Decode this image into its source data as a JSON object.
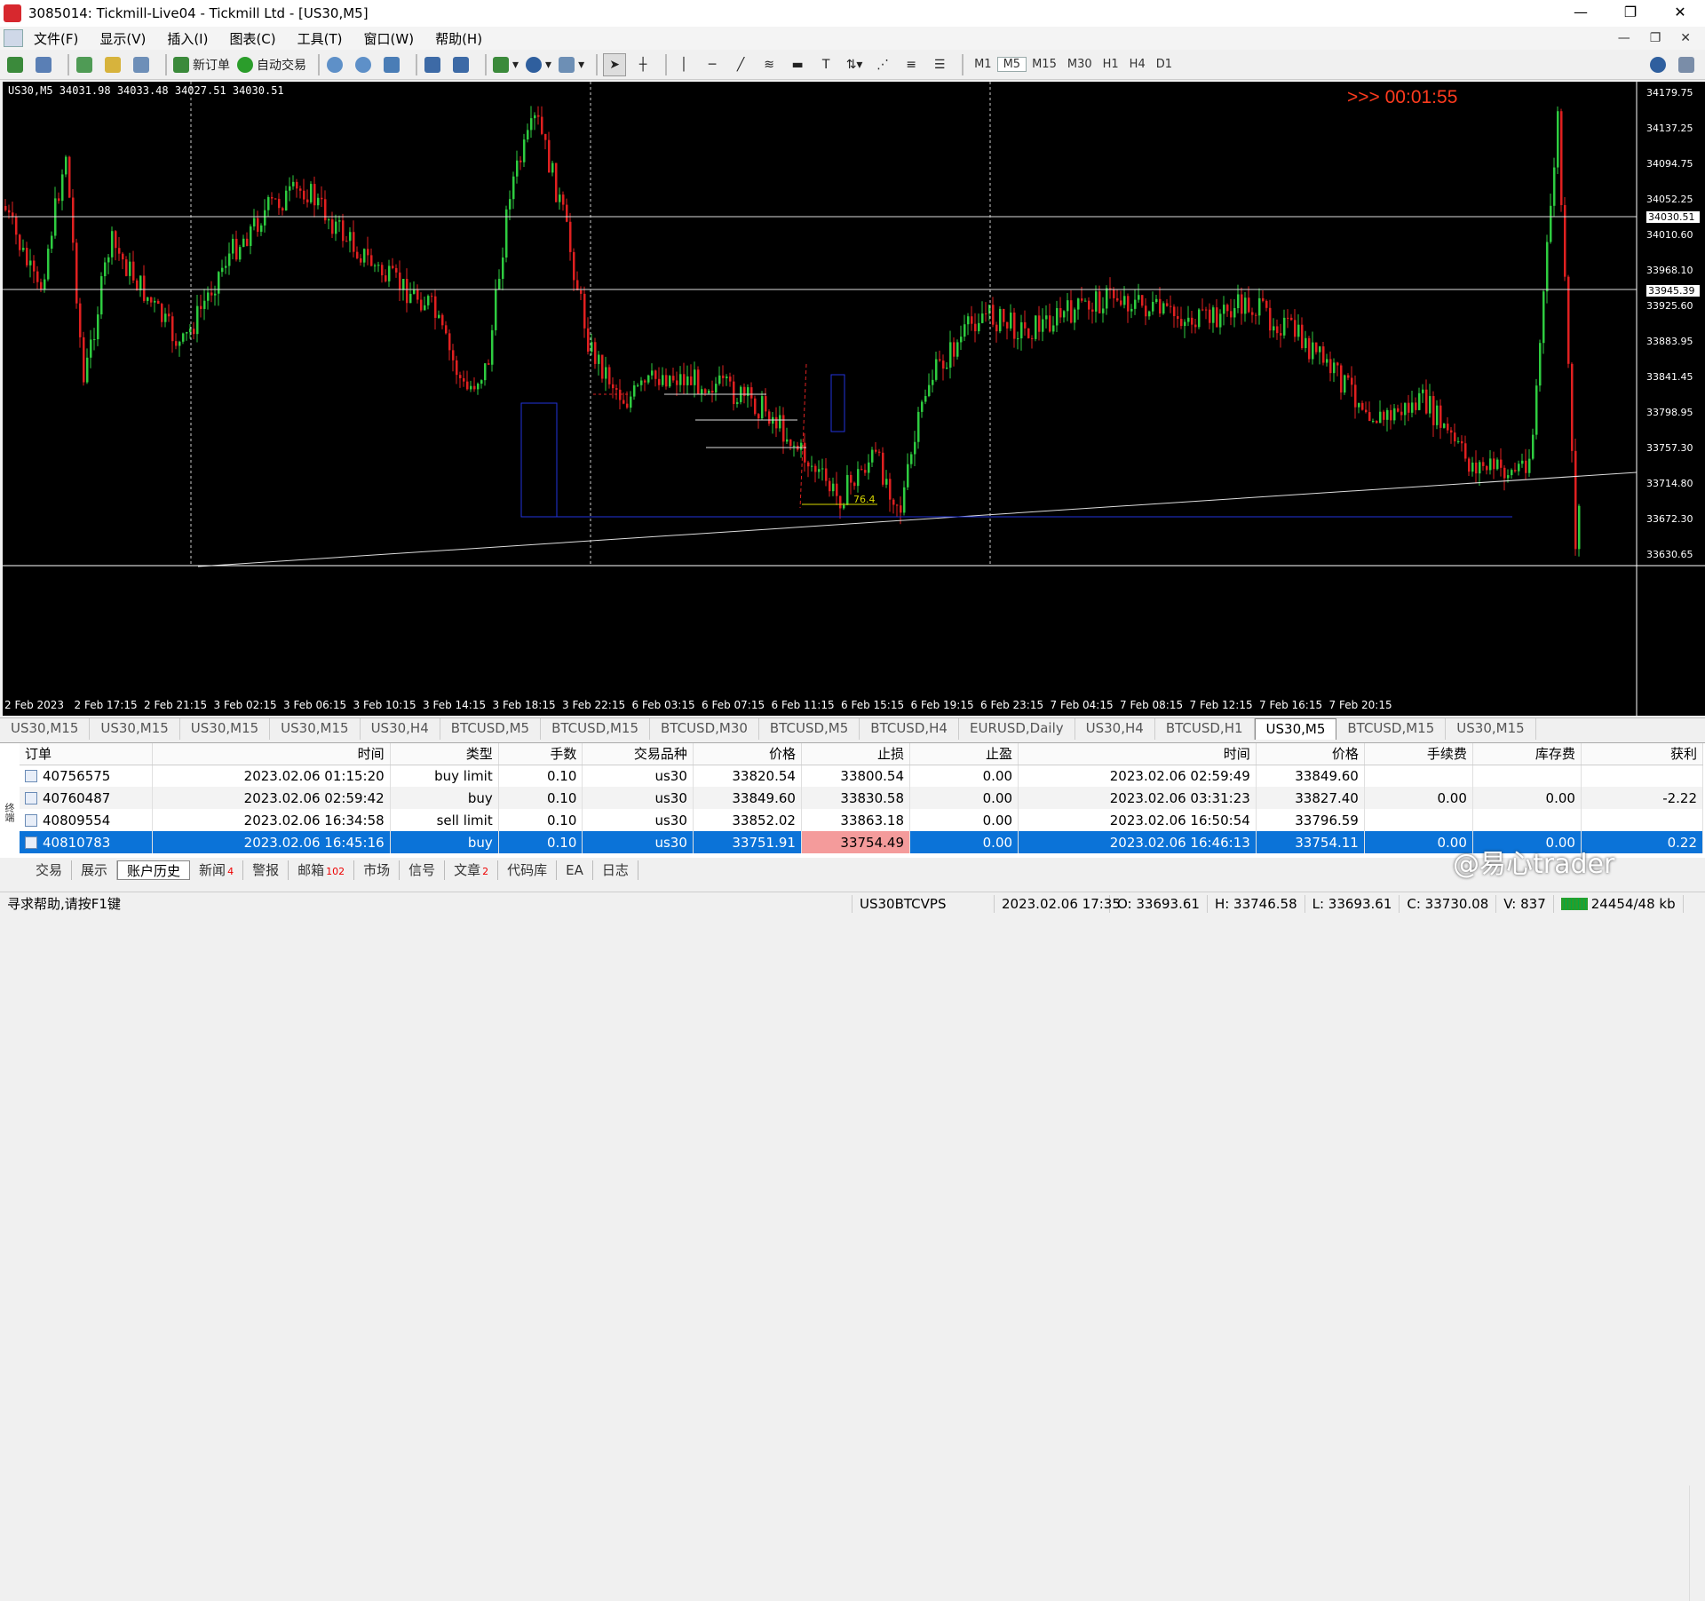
{
  "window": {
    "title": "3085014: Tickmill-Live04 - Tickmill Ltd - [US30,M5]",
    "controls": [
      "—",
      "❐",
      "✕"
    ]
  },
  "menu": {
    "items": [
      "文件(F)",
      "显示(V)",
      "插入(I)",
      "图表(C)",
      "工具(T)",
      "窗口(W)",
      "帮助(H)"
    ],
    "right": [
      "—",
      "❐",
      "✕"
    ]
  },
  "toolbar": {
    "new_order": "新订单",
    "auto_trade": "自动交易",
    "timeframes": [
      "M1",
      "M5",
      "M15",
      "M30",
      "H1",
      "H4",
      "D1"
    ],
    "active_timeframe": "M5"
  },
  "chart": {
    "header": "US30,M5  34031.98 34033.48 34027.51 34030.51",
    "timer": ">>> 00:01:55",
    "price_labels": [
      "34179.75",
      "34137.25",
      "34094.75",
      "34052.25",
      "34030.51",
      "34010.60",
      "33968.10",
      "33945.39",
      "33925.60",
      "33883.95",
      "33841.45",
      "33798.95",
      "33757.30",
      "33714.80",
      "33672.30",
      "33630.65"
    ],
    "time_labels": [
      "2 Feb 2023",
      "2 Feb 17:15",
      "2 Feb 21:15",
      "3 Feb 02:15",
      "3 Feb 06:15",
      "3 Feb 10:15",
      "3 Feb 14:15",
      "3 Feb 18:15",
      "3 Feb 22:15",
      "6 Feb 03:15",
      "6 Feb 07:15",
      "6 Feb 11:15",
      "6 Feb 15:15",
      "6 Feb 19:15",
      "6 Feb 23:15",
      "7 Feb 04:15",
      "7 Feb 08:15",
      "7 Feb 12:15",
      "7 Feb 16:15",
      "7 Feb 20:15"
    ],
    "fib_label": "76.4"
  },
  "chart_tabs": [
    "US30,M15",
    "US30,M15",
    "US30,M15",
    "US30,M15",
    "US30,H4",
    "BTCUSD,M5",
    "BTCUSD,M15",
    "BTCUSD,M30",
    "BTCUSD,M5",
    "BTCUSD,H4",
    "EURUSD,Daily",
    "US30,H4",
    "BTCUSD,H1",
    "US30,M5",
    "BTCUSD,M15",
    "US30,M15"
  ],
  "active_chart_tab": "US30,M5",
  "history_table": {
    "columns": [
      "订单",
      "时间",
      "类型",
      "手数",
      "交易品种",
      "价格",
      "止损",
      "止盈",
      "时间",
      "价格",
      "手续费",
      "库存费",
      "获利"
    ],
    "rows": [
      [
        "40756575",
        "2023.02.06 01:15:20",
        "buy limit",
        "0.10",
        "us30",
        "33820.54",
        "33800.54",
        "0.00",
        "2023.02.06 02:59:49",
        "33849.60",
        "",
        "",
        ""
      ],
      [
        "40760487",
        "2023.02.06 02:59:42",
        "buy",
        "0.10",
        "us30",
        "33849.60",
        "33830.58",
        "0.00",
        "2023.02.06 03:31:23",
        "33827.40",
        "0.00",
        "0.00",
        "-2.22"
      ],
      [
        "40809554",
        "2023.02.06 16:34:58",
        "sell limit",
        "0.10",
        "us30",
        "33852.02",
        "33863.18",
        "0.00",
        "2023.02.06 16:50:54",
        "33796.59",
        "",
        "",
        ""
      ],
      [
        "40810783",
        "2023.02.06 16:45:16",
        "buy",
        "0.10",
        "us30",
        "33751.91",
        "33754.49",
        "0.00",
        "2023.02.06 16:46:13",
        "33754.11",
        "0.00",
        "0.00",
        "0.22"
      ]
    ]
  },
  "bottom_tabs": [
    {
      "label": "交易",
      "badge": ""
    },
    {
      "label": "展示",
      "badge": ""
    },
    {
      "label": "账户历史",
      "badge": ""
    },
    {
      "label": "新闻",
      "badge": "4"
    },
    {
      "label": "警报",
      "badge": ""
    },
    {
      "label": "邮箱",
      "badge": "102"
    },
    {
      "label": "市场",
      "badge": ""
    },
    {
      "label": "信号",
      "badge": ""
    },
    {
      "label": "文章",
      "badge": "2"
    },
    {
      "label": "代码库",
      "badge": ""
    },
    {
      "label": "EA",
      "badge": ""
    },
    {
      "label": "日志",
      "badge": ""
    }
  ],
  "active_bottom_tab": "账户历史",
  "side_label": "终端",
  "watermark": "@易心trader",
  "status": {
    "help": "寻求帮助,请按F1键",
    "profile": "US30BTCVPS",
    "datetime": "2023.02.06 17:35",
    "open": "O: 33693.61",
    "high": "H: 33746.58",
    "low": "L: 33693.61",
    "close": "C: 33730.08",
    "volume": "V: 837",
    "traffic": "24454/48 kb"
  },
  "colors": {
    "bull": "#2ecc40",
    "bear": "#e02020",
    "selection": "#0b73d8",
    "stop_loss_hl": "#f49b9b",
    "timer": "#ff3b1e"
  }
}
